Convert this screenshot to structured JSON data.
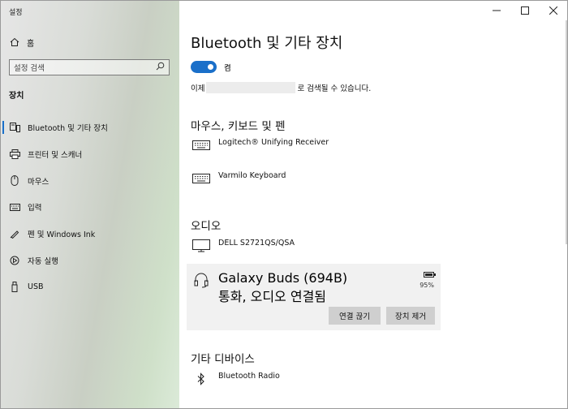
{
  "window": {
    "title": "설정",
    "controls": [
      "—",
      "☐",
      "✕"
    ]
  },
  "sidebar": {
    "home_label": "홈",
    "search_placeholder": "설정 검색",
    "section": "장치",
    "items": [
      {
        "label": "Bluetooth 및 기타 장치",
        "icon": "bluetooth-devices-icon",
        "active": true
      },
      {
        "label": "프린터 및 스캐너",
        "icon": "printer-icon"
      },
      {
        "label": "마우스",
        "icon": "mouse-icon"
      },
      {
        "label": "입력",
        "icon": "keyboard-icon"
      },
      {
        "label": "펜 및 Windows Ink",
        "icon": "pen-icon"
      },
      {
        "label": "자동 실행",
        "icon": "autoplay-icon"
      },
      {
        "label": "USB",
        "icon": "usb-icon"
      }
    ]
  },
  "main": {
    "title": "Bluetooth 및 기타 장치",
    "toggle_label": "켬",
    "toggle_on": true,
    "discover_prefix": "이제",
    "discover_suffix": "로 검색될 수 있습니다.",
    "groups": {
      "input": {
        "title": "마우스, 키보드 및 펜",
        "devices": [
          {
            "name": "Logitech® Unifying Receiver",
            "icon": "keyboard-icon"
          },
          {
            "name": "Varmilo Keyboard",
            "icon": "keyboard-icon"
          }
        ]
      },
      "audio": {
        "title": "오디오",
        "devices": [
          {
            "name": "DELL S2721QS/QSA",
            "icon": "monitor-icon"
          },
          {
            "name": "Galaxy Buds (694B)",
            "status": "통화, 오디오 연결됨",
            "battery": "95%",
            "icon": "headset-icon"
          }
        ],
        "buttons": {
          "disconnect": "연결 끊기",
          "remove": "장치 제거"
        }
      },
      "other": {
        "title": "기타 디바이스",
        "devices": [
          {
            "name": "Bluetooth Radio",
            "icon": "bluetooth-icon"
          }
        ]
      }
    }
  },
  "colors": {
    "accent": "#1a6fc9",
    "card_bg": "#f1f1f1",
    "button_bg": "#cfcfcf"
  }
}
